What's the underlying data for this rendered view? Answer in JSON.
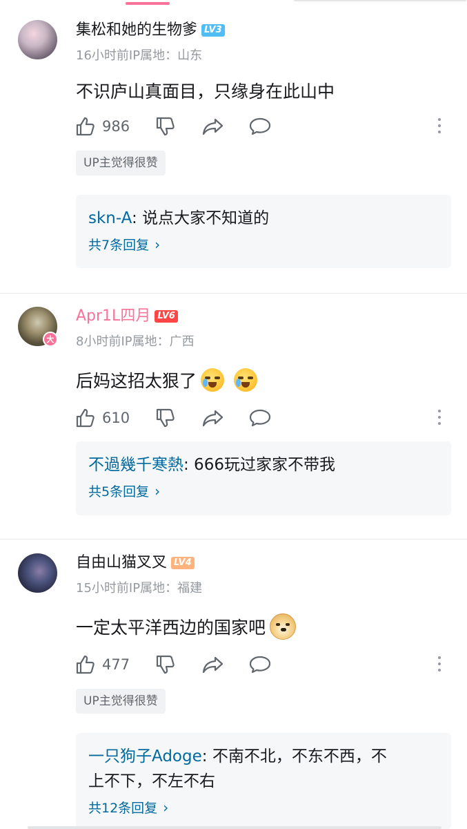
{
  "colors": {
    "accent": "#fb7299",
    "reply_name": "#00699d",
    "meta": "#9499a0",
    "lv3": "#50bdf5",
    "lv6": "#ff4545",
    "lv4": "#ffb37c"
  },
  "comments": [
    {
      "username": "集松和她的生物爹",
      "username_color": "#18191c",
      "level": "LV3",
      "meta": "16小时前IP属地：山东",
      "text": "不识庐山真面目，只缘身在此山中",
      "likes": "986",
      "up_tag": "UP主觉得很赞",
      "reply_name": "skn-A",
      "reply_text": ": 说点大家不知道的",
      "reply_text_2": "",
      "reply_count": "共7条回复",
      "avatar_icon": "avatar-supermarket"
    },
    {
      "username": "Apr1L四月",
      "username_color": "#fb7299",
      "level": "LV6",
      "meta": "8小时前IP属地：广西",
      "text": "后妈这招太狠了",
      "likes": "610",
      "up_tag": "",
      "reply_name": "不過幾千寒熱",
      "reply_text": ": 666玩过家家不带我",
      "reply_text_2": "",
      "reply_count": "共5条回复",
      "avatar_icon": "avatar-raccoon",
      "badge": "大"
    },
    {
      "username": "自由山猫叉叉",
      "username_color": "#18191c",
      "level": "LV4",
      "meta": "15小时前IP属地：福建",
      "text": "一定太平洋西边的国家吧",
      "likes": "477",
      "up_tag": "UP主觉得很赞",
      "reply_name": "一只狗子Adoge",
      "reply_text": ": 不南不北，不东不西，不",
      "reply_text_2": "上不下，不左不右",
      "reply_count": "共12条回复",
      "avatar_icon": "avatar-warrior"
    }
  ],
  "icons": {
    "like": "thumb-up-icon",
    "dislike": "thumb-down-icon",
    "share": "share-icon",
    "reply": "comment-icon",
    "more": "more-vertical-icon",
    "chevron": "chevron-right-icon"
  },
  "chevron_glyph": "›"
}
